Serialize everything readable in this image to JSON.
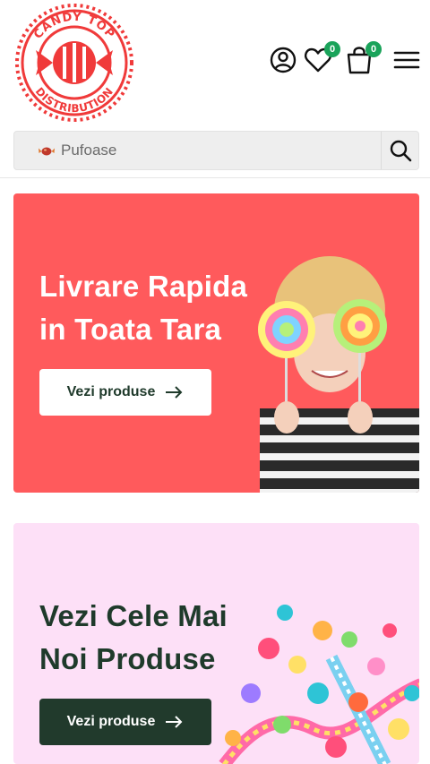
{
  "brand": {
    "logo_text": "CANDY TOP DISTRIBUTION",
    "color": "#f03a3a"
  },
  "header": {
    "wishlist_count": "0",
    "cart_count": "0",
    "badge_color": "#1aa35a"
  },
  "search": {
    "placeholder": "Pufoase",
    "value": ""
  },
  "banners": [
    {
      "title_line1": "Livrare Rapida",
      "title_line2": "in Toata Tara",
      "cta_label": "Vezi produse",
      "bg": "#ff5a5c"
    },
    {
      "title_line1": "Vezi Cele Mai",
      "title_line2": "Noi Produse",
      "cta_label": "Vezi produse",
      "bg": "#fde0f7"
    }
  ],
  "icons": [
    "account-icon",
    "heart-icon",
    "bag-icon",
    "hamburger-icon",
    "search-icon",
    "arrow-right-icon",
    "candy-icon"
  ]
}
